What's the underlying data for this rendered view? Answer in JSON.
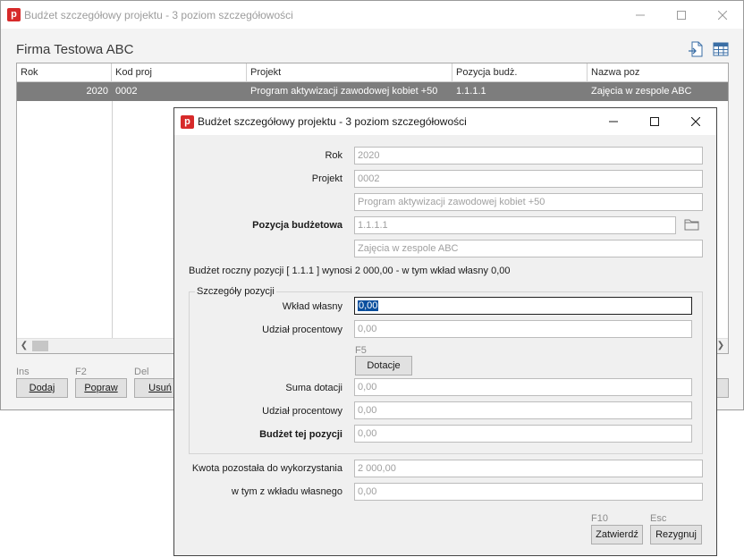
{
  "background": {
    "title": "Budżet szczegółowy projektu - 3 poziom szczegółowości",
    "company": "Firma Testowa ABC",
    "columns": [
      "Rok",
      "Kod proj",
      "Projekt",
      "Pozycja budż.",
      "Nazwa poz"
    ],
    "row": [
      "2020",
      "0002",
      "Program aktywizacji zawodowej kobiet +50",
      "1.1.1.1",
      "Zajęcia w zespole ABC"
    ],
    "shortcuts": {
      "add": "Ins",
      "edit": "F2",
      "delete": "Del"
    },
    "buttons": {
      "add": "Dodaj",
      "edit": "Popraw",
      "delete": "Usuń"
    }
  },
  "dialog": {
    "title": "Budżet szczegółowy projektu - 3 poziom szczegółowości",
    "labels": {
      "rok": "Rok",
      "projekt": "Projekt",
      "pozycja": "Pozycja budżetowa",
      "wklad": "Wkład własny",
      "udzial1": "Udział procentowy",
      "suma": "Suma dotacji",
      "udzial2": "Udział procentowy",
      "budzet": "Budżet tej pozycji",
      "kwota": "Kwota pozostała do wykorzystania",
      "wtym": "w tym z wkładu własnego"
    },
    "values": {
      "rok": "2020",
      "projekt_kod": "0002",
      "projekt_nazwa": "Program aktywizacji zawodowej kobiet +50",
      "pozycja_kod": "1.1.1.1",
      "pozycja_nazwa": "Zajęcia w zespole ABC",
      "wklad": "0,00",
      "udzial1": "0,00",
      "suma": "0,00",
      "udzial2": "0,00",
      "budzet": "0,00",
      "kwota": "2 000,00",
      "wtym": "0,00"
    },
    "info": "Budżet roczny pozycji  [ 1.1.1 ]  wynosi 2 000,00  -  w tym wkład własny 0,00",
    "group_title": "Szczegóły pozycji",
    "dotacje_key": "F5",
    "dotacje_label": "Dotacje",
    "ok_key": "F10",
    "ok_label": "Zatwierdź",
    "cancel_key": "Esc",
    "cancel_label": "Rezygnuj"
  },
  "colors": {
    "accent": "#d72a2a",
    "selection_row": "#7d7d7d",
    "text_selection": "#0a4f9e"
  }
}
